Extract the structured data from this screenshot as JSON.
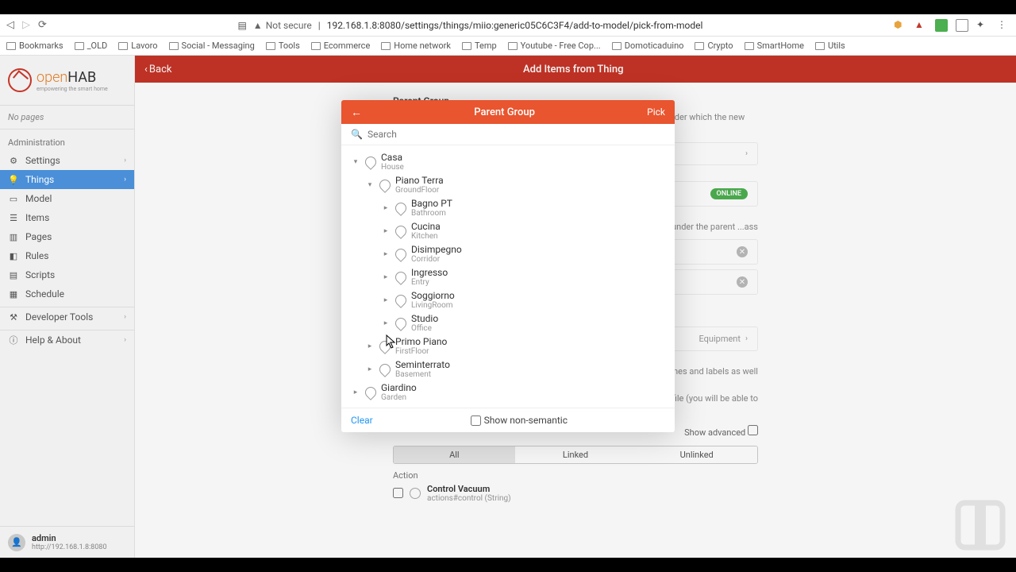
{
  "browser": {
    "not_secure": "Not secure",
    "url": "192.168.1.8:8080/settings/things/miio:generic05C6C3F4/add-to-model/pick-from-model"
  },
  "bookmarks": [
    "Bookmarks",
    "_OLD",
    "Lavoro",
    "Social - Messaging",
    "Tools",
    "Ecommerce",
    "Home network",
    "Temp",
    "Youtube - Free Cop...",
    "Domoticaduino",
    "Crypto",
    "SmartHome",
    "Utils"
  ],
  "logo": {
    "brand1": "open",
    "brand2": "HAB",
    "tagline": "empowering the smart home"
  },
  "sidebar": {
    "no_pages": "No pages",
    "admin": "Administration",
    "items": {
      "settings": "Settings",
      "things": "Things",
      "model": "Model",
      "items_lbl": "Items",
      "pages": "Pages",
      "rules": "Rules",
      "scripts": "Scripts",
      "schedule": "Schedule"
    },
    "dev_tools": "Developer Tools",
    "help": "Help & About",
    "user": {
      "name": "admin",
      "host": "http://192.168.1.8:8080"
    }
  },
  "topbar": {
    "back": "Back",
    "title": "Add Items from Thing"
  },
  "page": {
    "parent_group": "Parent Group",
    "parent_desc": "Select the parent Location or Equipment group in the semantic model, under which the new items will be inserted (optional, but recommended).",
    "online": "ONLINE",
    "hint_under_parent": "...ed under the parent ...ass",
    "equipment": "Equipment",
    "names_labels_hint": "...t names and labels as well",
    "profile_hint": "...ofile (you will be able to",
    "show_advanced": "Show advanced",
    "tabs": {
      "all": "All",
      "linked": "Linked",
      "unlinked": "Unlinked"
    },
    "action": "Action",
    "control_vacuum": "Control Vacuum",
    "control_sub": "actions#control (String)"
  },
  "modal": {
    "title": "Parent Group",
    "pick": "Pick",
    "search_ph": "Search",
    "clear": "Clear",
    "show_ns": "Show non-semantic",
    "tree": [
      {
        "label": "Casa",
        "sub": "House",
        "indent": 0,
        "toggle": "▾"
      },
      {
        "label": "Piano Terra",
        "sub": "GroundFloor",
        "indent": 1,
        "toggle": "▾"
      },
      {
        "label": "Bagno PT",
        "sub": "Bathroom",
        "indent": 2,
        "toggle": "▸"
      },
      {
        "label": "Cucina",
        "sub": "Kitchen",
        "indent": 2,
        "toggle": "▸"
      },
      {
        "label": "Disimpegno",
        "sub": "Corridor",
        "indent": 2,
        "toggle": "▸"
      },
      {
        "label": "Ingresso",
        "sub": "Entry",
        "indent": 2,
        "toggle": "▸"
      },
      {
        "label": "Soggiorno",
        "sub": "LivingRoom",
        "indent": 2,
        "toggle": "▸"
      },
      {
        "label": "Studio",
        "sub": "Office",
        "indent": 2,
        "toggle": "▸"
      },
      {
        "label": "Primo Piano",
        "sub": "FirstFloor",
        "indent": 1,
        "toggle": "▸"
      },
      {
        "label": "Seminterrato",
        "sub": "Basement",
        "indent": 1,
        "toggle": "▸"
      },
      {
        "label": "Giardino",
        "sub": "Garden",
        "indent": 0,
        "toggle": "▸"
      }
    ]
  }
}
